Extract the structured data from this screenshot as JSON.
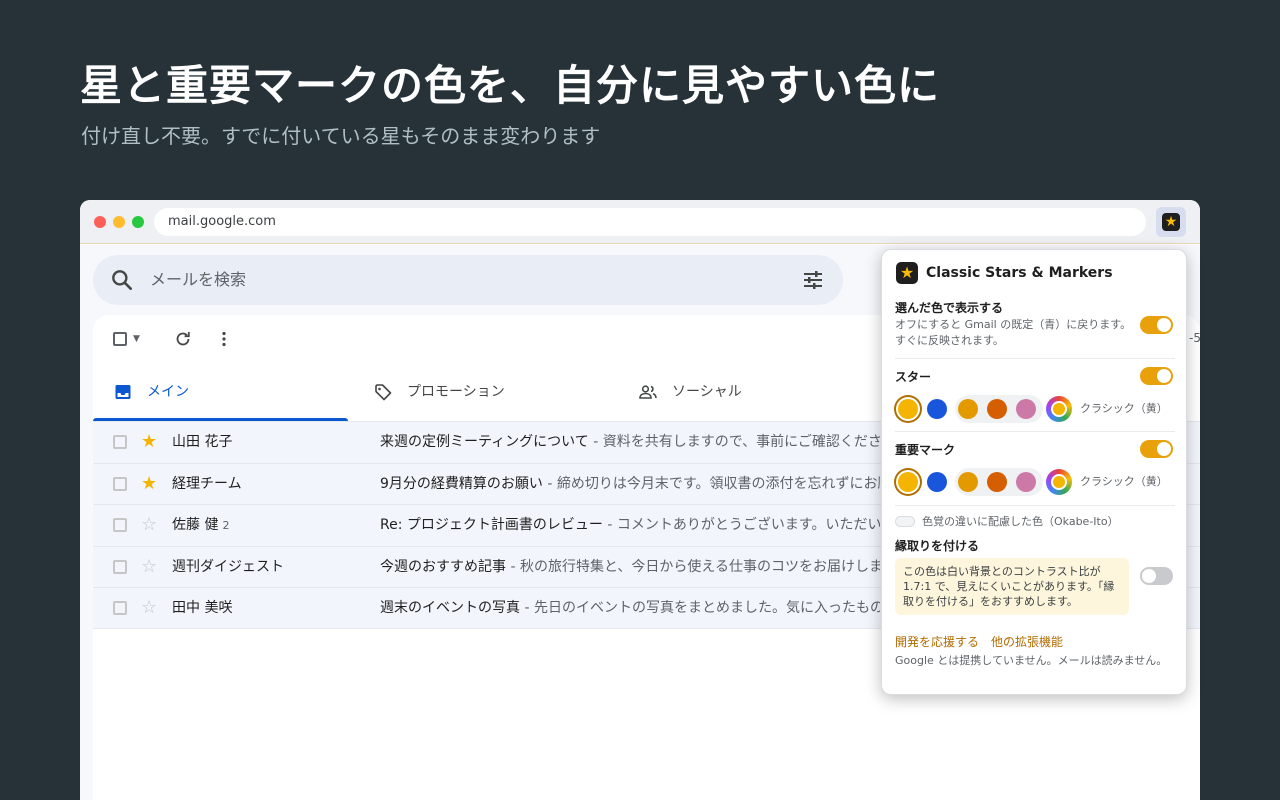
{
  "hero": {
    "title": "星と重要マークの色を、自分に見やすい色に",
    "subtitle": "付け直し不要。すでに付いている星もそのまま変わります"
  },
  "browser": {
    "url": "mail.google.com",
    "extension_icon": "star-icon"
  },
  "gmail": {
    "search_placeholder": "メールを検索",
    "range_text": "-5",
    "tabs": [
      {
        "label": "メイン",
        "icon": "inbox-icon",
        "active": true
      },
      {
        "label": "プロモーション",
        "icon": "tag-icon",
        "active": false
      },
      {
        "label": "ソーシャル",
        "icon": "people-icon",
        "active": false
      }
    ],
    "emails": [
      {
        "sender": "山田 花子",
        "count": "",
        "starred": true,
        "subject": "来週の定例ミーティングについて",
        "snippet": " - 資料を共有しますので、事前にご確認ください"
      },
      {
        "sender": "経理チーム",
        "count": "",
        "starred": true,
        "subject": "9月分の経費精算のお願い",
        "snippet": " - 締め切りは今月末です。領収書の添付を忘れずにお願い"
      },
      {
        "sender": "佐藤 健",
        "count": "2",
        "starred": false,
        "subject": "Re: プロジェクト計画書のレビュー",
        "snippet": " - コメントありがとうございます。いただいた"
      },
      {
        "sender": "週刊ダイジェスト",
        "count": "",
        "starred": false,
        "subject": "今週のおすすめ記事",
        "snippet": " - 秋の旅行特集と、今日から使える仕事のコツをお届けします"
      },
      {
        "sender": "田中 美咲",
        "count": "",
        "starred": false,
        "subject": "週末のイベントの写真",
        "snippet": " - 先日のイベントの写真をまとめました。気に入ったものが"
      }
    ],
    "star_color": "#f4b400",
    "accent": "#0b57d0"
  },
  "popup": {
    "title": "Classic Stars & Markers",
    "show_colors": {
      "heading": "選んだ色で表示する",
      "description": "オフにすると Gmail の既定（青）に戻ります。すぐに反映されます。",
      "enabled": true
    },
    "stars": {
      "heading": "スター",
      "enabled": true,
      "selected_label": "クラシック（黄）",
      "swatches": [
        "#f4b400",
        "#1a56db",
        "#e29a00",
        "#d55e00",
        "#cc79a7"
      ]
    },
    "markers": {
      "heading": "重要マーク",
      "enabled": true,
      "selected_label": "クラシック（黄）",
      "swatches": [
        "#f4b400",
        "#1a56db",
        "#e29a00",
        "#d55e00",
        "#cc79a7"
      ]
    },
    "colorblind_option": "色覚の違いに配慮した色（Okabe-Ito）",
    "outline": {
      "heading": "縁取りを付ける",
      "warning": "この色は白い背景とのコントラスト比が 1.7:1 で、見えにくいことがあります。「縁取りを付ける」をおすすめします。",
      "enabled": false
    },
    "links": [
      "開発を応援する",
      "他の拡張機能"
    ],
    "footer": "Google とは提携していません。メールは読みません。",
    "accent": "#e8a10b"
  }
}
